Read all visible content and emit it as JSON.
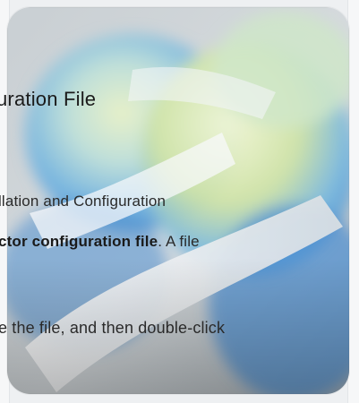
{
  "document": {
    "title": "uration File",
    "line1": "llation and Configuration",
    "line2_bold": "ctor configuration file",
    "line2_rest": ". A file",
    "line3": "e the file, and then double-click"
  },
  "icon": {
    "name": "network-globe-icon"
  },
  "colors": {
    "background": "#eef0f2",
    "icon_blue": "#4a8fd6",
    "icon_green": "#c9d96a",
    "icon_white": "#f4f6f8",
    "text": "#1a1a1a"
  }
}
